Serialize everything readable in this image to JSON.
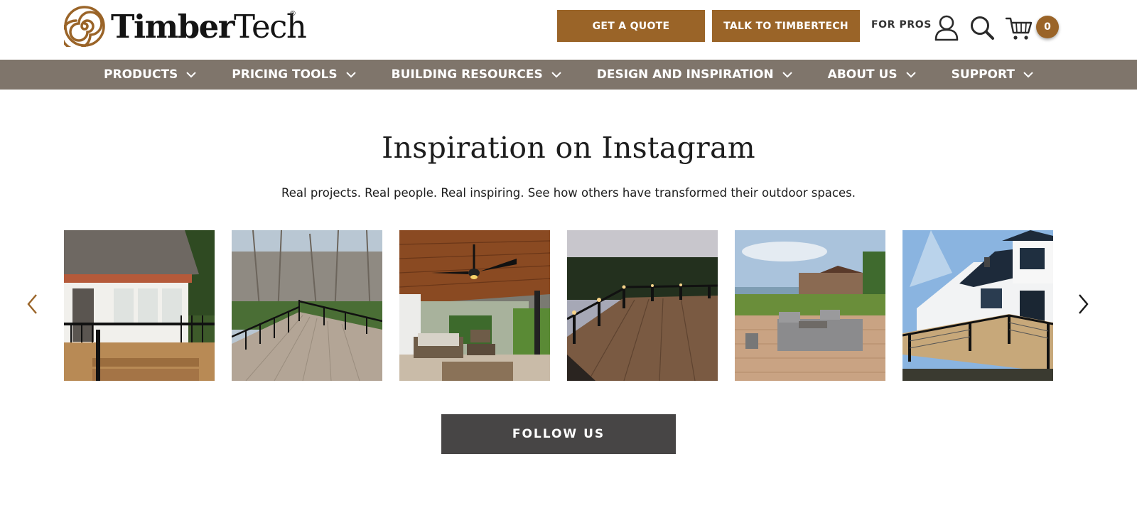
{
  "header": {
    "logo_bold": "Timber",
    "logo_light": "Tech",
    "logo_reg": "®",
    "get_quote": "GET A QUOTE",
    "talk": "TALK TO TIMBERTECH",
    "for_pros": "FOR PROS",
    "cart_count": "0",
    "icons": [
      "spiral-logo-icon",
      "user-icon",
      "search-icon",
      "cart-icon"
    ]
  },
  "nav": {
    "items": [
      {
        "label": "PRODUCTS"
      },
      {
        "label": "PRICING TOOLS"
      },
      {
        "label": "BUILDING RESOURCES"
      },
      {
        "label": "DESIGN AND INSPIRATION"
      },
      {
        "label": "ABOUT US"
      },
      {
        "label": "SUPPORT"
      }
    ]
  },
  "main": {
    "title": "Inspiration on Instagram",
    "subtitle": "Real projects. Real people. Real inspiring. See how others have transformed their outdoor spaces.",
    "follow": "FOLLOW US"
  },
  "colors": {
    "brand_brown": "#9a6428",
    "nav_bg": "#7f756b",
    "follow_bg": "#474545"
  }
}
